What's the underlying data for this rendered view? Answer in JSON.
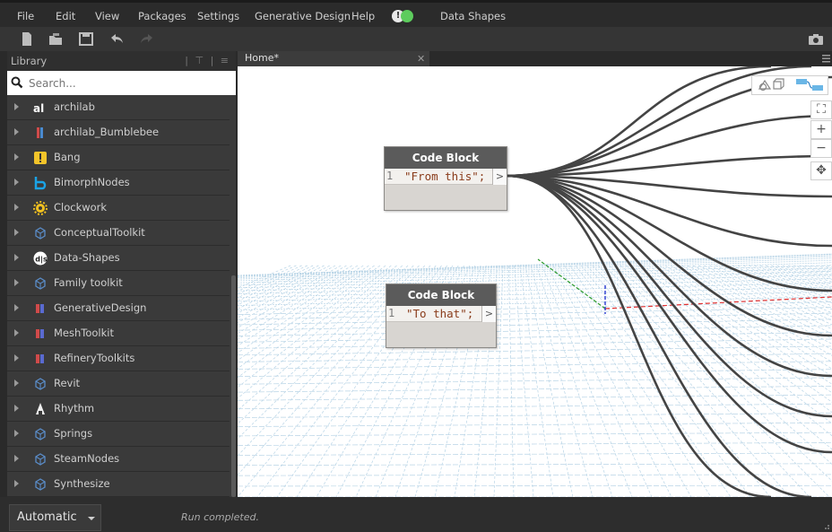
{
  "menu": {
    "file": "File",
    "edit": "Edit",
    "view": "View",
    "packages": "Packages",
    "settings": "Settings",
    "generative_design": "Generative Design",
    "help": "Help",
    "notification_symbol": "!",
    "data_shapes": "Data Shapes"
  },
  "toolbar": {
    "icons": [
      "new-file-icon",
      "open-file-icon",
      "save-icon",
      "undo-icon",
      "redo-icon",
      "screenshot-camera-icon"
    ]
  },
  "library": {
    "title": "Library",
    "search_placeholder": "Search...",
    "items": [
      {
        "label": "archilab",
        "icon": "archilab-icon"
      },
      {
        "label": "archilab_Bumblebee",
        "icon": "bumblebee-icon"
      },
      {
        "label": "Bang",
        "icon": "bang-icon"
      },
      {
        "label": "BimorphNodes",
        "icon": "bimorph-icon"
      },
      {
        "label": "Clockwork",
        "icon": "clockwork-gear-icon"
      },
      {
        "label": "ConceptualToolkit",
        "icon": "package-icon"
      },
      {
        "label": "Data-Shapes",
        "icon": "data-shapes-icon"
      },
      {
        "label": "Family toolkit",
        "icon": "package-icon"
      },
      {
        "label": "GenerativeDesign",
        "icon": "generative-design-icon"
      },
      {
        "label": "MeshToolkit",
        "icon": "generative-design-icon"
      },
      {
        "label": "RefineryToolkits",
        "icon": "generative-design-icon"
      },
      {
        "label": "Revit",
        "icon": "package-icon"
      },
      {
        "label": "Rhythm",
        "icon": "rhythm-icon"
      },
      {
        "label": "Springs",
        "icon": "package-icon"
      },
      {
        "label": "SteamNodes",
        "icon": "package-icon"
      },
      {
        "label": "Synthesize",
        "icon": "package-icon"
      }
    ]
  },
  "tabs": [
    {
      "label": "Home*",
      "active": true
    }
  ],
  "canvas": {
    "nodes": [
      {
        "title": "Code Block",
        "line": "1",
        "code": "\"From this\";",
        "port": ">"
      },
      {
        "title": "Code Block",
        "line": "1",
        "code": "\"To that\";",
        "port": ">"
      }
    ],
    "zoom": {
      "fit": "⛶",
      "zoom_in": "+",
      "zoom_out": "−",
      "pan": "✥"
    }
  },
  "status": {
    "run_mode": "Automatic",
    "message": "Run completed."
  },
  "colors": {
    "menu_bg": "#2b2b2b",
    "library_bg": "#3a3a3a",
    "node_header": "#5b5b5b",
    "code_string": "#8a3c1b",
    "grid_line": "#b8d4e6",
    "x_axis": "#e03030",
    "y_axis": "#2a9a2a",
    "z_axis": "#2a3ad0",
    "wire": "#444444"
  }
}
